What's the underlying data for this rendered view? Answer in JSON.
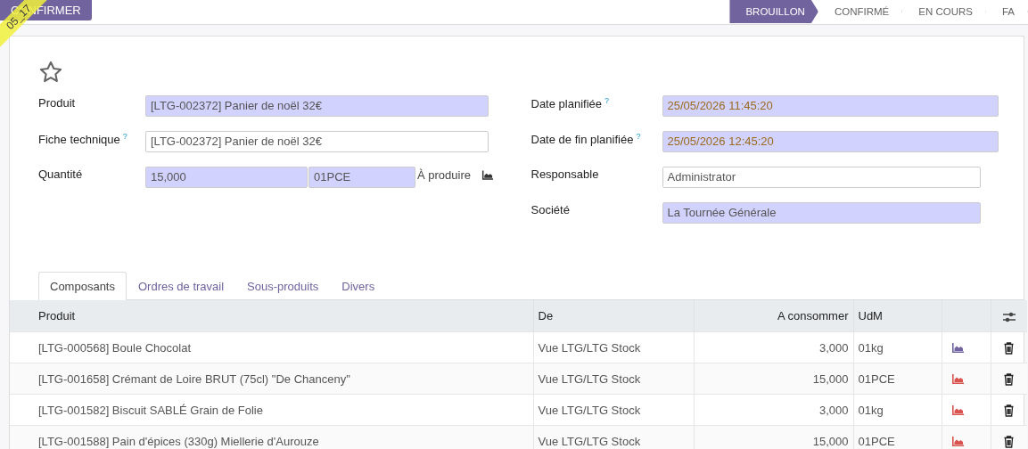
{
  "ribbon": {
    "text": "05_17"
  },
  "actions": [
    {
      "label": "CONFIRMER"
    }
  ],
  "stages": [
    {
      "label": "BROUILLON",
      "selected": true
    },
    {
      "label": "CONFIRMÉ",
      "selected": false
    },
    {
      "label": "EN COURS",
      "selected": false
    },
    {
      "label": "FA",
      "selected": false
    }
  ],
  "favorite": {
    "starred": false
  },
  "left_fields": [
    {
      "label": "Produit",
      "help": false,
      "value": "[LTG-002372] Panier de noël 32€",
      "required": true,
      "warning": false
    },
    {
      "label": "Fiche technique",
      "help": true,
      "value": "[LTG-002372] Panier de noël 32€",
      "required": false,
      "warning": false
    }
  ],
  "quantity": {
    "label": "Quantité",
    "value": "15,000",
    "unit": "01PCE",
    "suffix": "À produire"
  },
  "right_fields": [
    {
      "label": "Date planifiée",
      "help": true,
      "value": "25/05/2026 11:45:20",
      "required": true,
      "warning": true
    },
    {
      "label": "Date de fin planifiée",
      "help": true,
      "value": "25/05/2026 12:45:20",
      "required": true,
      "warning": true
    },
    {
      "label": "Responsable",
      "help": false,
      "value": "Administrator",
      "required": false,
      "warning": false
    },
    {
      "label": "Société",
      "help": false,
      "value": "La Tournée Générale",
      "required": true,
      "warning": false
    }
  ],
  "help_mark": "?",
  "tabs": [
    {
      "label": "Composants",
      "selected": true
    },
    {
      "label": "Ordres de travail",
      "selected": false
    },
    {
      "label": "Sous-produits",
      "selected": false
    },
    {
      "label": "Divers",
      "selected": false
    }
  ],
  "table": {
    "columns": [
      "Produit",
      "De",
      "A consommer",
      "UdM"
    ],
    "rows": [
      {
        "product": "[LTG-000568] Boule Chocolat",
        "from": "Vue LTG/LTG Stock",
        "qty": "3,000",
        "uom": "01kg",
        "color": "#71639e"
      },
      {
        "product": "[LTG-001658] Crémant de Loire BRUT (75cl) \"De Chanceny\"",
        "from": "Vue LTG/LTG Stock",
        "qty": "15,000",
        "uom": "01PCE",
        "color": "#d9534f"
      },
      {
        "product": "[LTG-001582] Biscuit SABLÉ Grain de Folie",
        "from": "Vue LTG/LTG Stock",
        "qty": "3,000",
        "uom": "01kg",
        "color": "#d9534f"
      },
      {
        "product": "[LTG-001588] Pain d'épices (330g) Miellerie d'Aurouze",
        "from": "Vue LTG/LTG Stock",
        "qty": "15,000",
        "uom": "01PCE",
        "color": "#d9534f"
      }
    ]
  }
}
